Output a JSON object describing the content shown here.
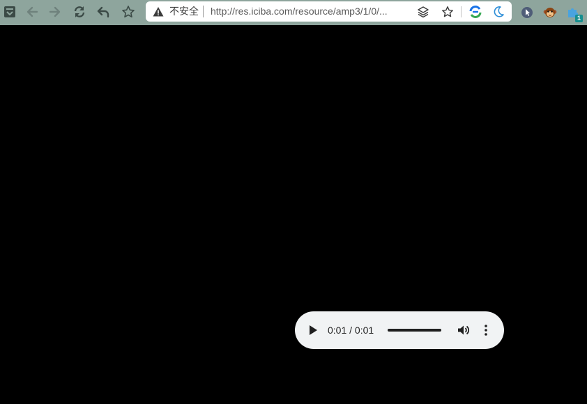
{
  "toolbar": {
    "colors": {
      "background": "#8ea59d",
      "icon": "#3b4a46"
    },
    "buttons": [
      {
        "name": "tab-list-icon"
      },
      {
        "name": "back-icon"
      },
      {
        "name": "forward-icon"
      },
      {
        "name": "reload-icon"
      },
      {
        "name": "undo-icon"
      },
      {
        "name": "bookmark-star-icon"
      }
    ]
  },
  "omnibox": {
    "security_label": "不安全",
    "url": "http://res.iciba.com/resource/amp3/1/0/...",
    "right_icons": [
      "reader-mode-icon",
      "bookmark-star-icon",
      "translate-extension-icon",
      "dark-mode-moon-icon"
    ]
  },
  "extensions": [
    {
      "name": "cursor-extension-icon"
    },
    {
      "name": "monkey-extension-icon"
    },
    {
      "name": "puzzle-extension-icon",
      "badge": "1"
    }
  ],
  "audio_player": {
    "current_time": "0:01",
    "separator": " / ",
    "duration": "0:01",
    "progress": 1.0,
    "colors": {
      "background": "#f1f3f4",
      "foreground": "#1f1f1f"
    }
  }
}
